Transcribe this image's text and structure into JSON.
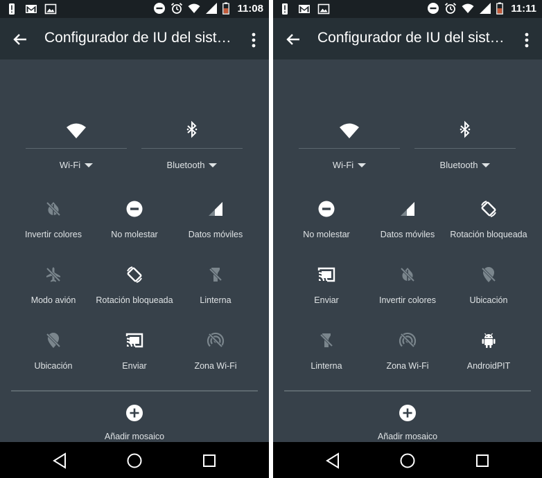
{
  "screens": [
    {
      "status": {
        "time": "11:08"
      },
      "toolbar": {
        "title": "Configurador de IU del sist…"
      },
      "big_tiles": [
        {
          "label": "Wi-Fi",
          "icon": "wifi-icon"
        },
        {
          "label": "Bluetooth",
          "icon": "bluetooth-icon"
        }
      ],
      "tiles": [
        {
          "label": "Invertir colores",
          "icon": "invert-colors-off-icon",
          "active": false
        },
        {
          "label": "No molestar",
          "icon": "do-not-disturb-icon",
          "active": true
        },
        {
          "label": "Datos móviles",
          "icon": "signal-icon",
          "active": true
        },
        {
          "label": "Modo avión",
          "icon": "airplane-off-icon",
          "active": false
        },
        {
          "label": "Rotación bloqueada",
          "icon": "rotation-lock-icon",
          "active": true
        },
        {
          "label": "Linterna",
          "icon": "flashlight-off-icon",
          "active": false
        },
        {
          "label": "Ubicación",
          "icon": "location-off-icon",
          "active": false
        },
        {
          "label": "Enviar",
          "icon": "cast-icon",
          "active": true
        },
        {
          "label": "Zona Wi-Fi",
          "icon": "hotspot-off-icon",
          "active": false
        }
      ],
      "add_tile": {
        "label": "Añadir mosaico"
      }
    },
    {
      "status": {
        "time": "11:11"
      },
      "toolbar": {
        "title": "Configurador de IU del sist…"
      },
      "big_tiles": [
        {
          "label": "Wi-Fi",
          "icon": "wifi-icon"
        },
        {
          "label": "Bluetooth",
          "icon": "bluetooth-icon"
        }
      ],
      "tiles": [
        {
          "label": "No molestar",
          "icon": "do-not-disturb-icon",
          "active": true
        },
        {
          "label": "Datos móviles",
          "icon": "signal-icon",
          "active": true
        },
        {
          "label": "Rotación bloqueada",
          "icon": "rotation-lock-icon",
          "active": true
        },
        {
          "label": "Enviar",
          "icon": "cast-icon",
          "active": true
        },
        {
          "label": "Invertir colores",
          "icon": "invert-colors-off-icon",
          "active": false
        },
        {
          "label": "Ubicación",
          "icon": "location-off-icon",
          "active": false
        },
        {
          "label": "Linterna",
          "icon": "flashlight-off-icon",
          "active": false
        },
        {
          "label": "Zona Wi-Fi",
          "icon": "hotspot-off-icon",
          "active": false
        },
        {
          "label": "AndroidPIT",
          "icon": "android-icon",
          "active": true
        }
      ],
      "add_tile": {
        "label": "Añadir mosaico"
      }
    }
  ],
  "colors": {
    "screen_bg": "#37414a",
    "toolbar_bg": "#263036",
    "statusbar_bg": "#1a2024",
    "icon_active": "#ffffff",
    "icon_inactive": "#7b868d",
    "label": "#dfe3e5"
  }
}
